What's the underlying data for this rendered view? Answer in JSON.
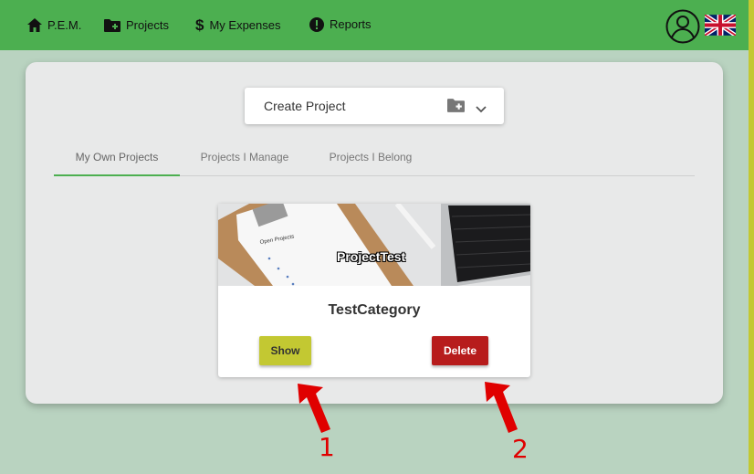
{
  "nav": {
    "home": "P.E.M.",
    "projects": "Projects",
    "expenses": "My Expenses",
    "reports": "Reports"
  },
  "create_project": {
    "label": "Create Project"
  },
  "tabs": [
    {
      "label": "My Own Projects",
      "active": true
    },
    {
      "label": "Projects I Manage",
      "active": false
    },
    {
      "label": "Projects I Belong",
      "active": false
    }
  ],
  "project_card": {
    "image_title": "ProjectTest",
    "image_note": "Open Projects",
    "category": "TestCategory",
    "show_label": "Show",
    "delete_label": "Delete"
  },
  "annotations": {
    "one": "1",
    "two": "2"
  },
  "colors": {
    "navbar": "#4caf50",
    "background": "#b9d3c0",
    "show_button": "#c3c832",
    "delete_button": "#b71c1c",
    "active_tab": "#4caf50",
    "arrow": "#e00000"
  },
  "icons": [
    "home-icon",
    "folder-plus-icon",
    "dollar-icon",
    "alert-icon",
    "user-avatar-icon",
    "uk-flag-icon",
    "chevron-down-icon"
  ]
}
